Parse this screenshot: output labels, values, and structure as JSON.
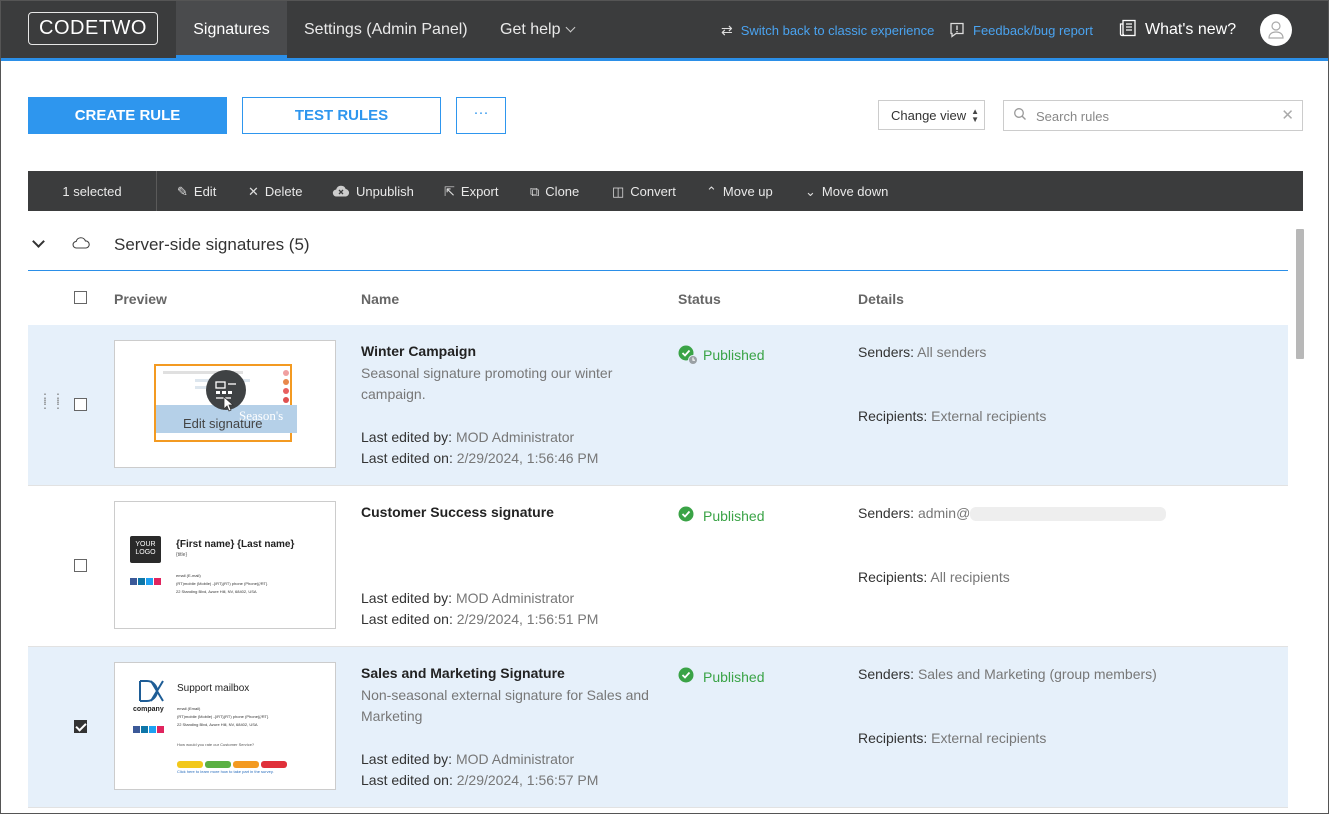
{
  "app": {
    "logo": "CODETWO",
    "nav": [
      {
        "label": "Signatures",
        "active": true
      },
      {
        "label": "Settings (Admin Panel)",
        "active": false
      },
      {
        "label": "Get help",
        "active": false
      }
    ],
    "links": {
      "switch_classic": "Switch back to classic experience",
      "feedback": "Feedback/bug report",
      "whats_new": "What's new?"
    },
    "accent_color": "#2b8fe8"
  },
  "actions": {
    "create_rule": "CREATE RULE",
    "test_rules": "TEST RULES",
    "more": "···",
    "change_view": "Change view",
    "search_placeholder": "Search rules"
  },
  "toolbar": {
    "selected": "1 selected",
    "items": [
      "Edit",
      "Delete",
      "Unpublish",
      "Export",
      "Clone",
      "Convert",
      "Move up",
      "Move down"
    ]
  },
  "group": {
    "title": "Server-side signatures (5)"
  },
  "table": {
    "headers": {
      "preview": "Preview",
      "name": "Name",
      "status": "Status",
      "details": "Details"
    },
    "rows": [
      {
        "name": "Winter Campaign",
        "description": "Seasonal signature promoting our winter campaign.",
        "edited_by_label": "Last edited by:",
        "edited_by": "MOD Administrator",
        "edited_on_label": "Last edited on:",
        "edited_on": "2/29/2024, 1:56:46 PM",
        "status": "Published",
        "senders_label": "Senders:",
        "senders": "All senders",
        "recipients_label": "Recipients:",
        "recipients": "External recipients",
        "checked": false,
        "hover_label": "Edit signature",
        "preview_text": "Season's"
      },
      {
        "name": "Customer Success signature",
        "description": "",
        "edited_by_label": "Last edited by:",
        "edited_by": "MOD Administrator",
        "edited_on_label": "Last edited on:",
        "edited_on": "2/29/2024, 1:56:51 PM",
        "status": "Published",
        "senders_label": "Senders:",
        "senders": "admin@",
        "recipients_label": "Recipients:",
        "recipients": "All recipients",
        "checked": false,
        "preview_logo": "YOUR LOGO",
        "preview_name": "{First name} {Last name}",
        "preview_title": "{title}",
        "preview_lines": [
          "email (E-mail)",
          "(RT)mobile (Mobile) -{/RT}(RT) phone (Phone){/RT}",
          "22 Standing Blvd, Azure Hill, NV, 68402, USA"
        ]
      },
      {
        "name": "Sales and Marketing Signature",
        "description": "Non-seasonal external signature for Sales and Marketing",
        "edited_by_label": "Last edited by:",
        "edited_by": "MOD Administrator",
        "edited_on_label": "Last edited on:",
        "edited_on": "2/29/2024, 1:56:57 PM",
        "status": "Published",
        "senders_label": "Senders:",
        "senders": "Sales and Marketing (group members)",
        "recipients_label": "Recipients:",
        "recipients": "External recipients",
        "checked": true,
        "preview_company": "company",
        "preview_name": "Support mailbox",
        "preview_lines": [
          "email (Email)",
          "(RT)mobile (Mobile) -{/RT}(RT) phone (Phone){/RT}",
          "22 Standing Blvd, Azure Hill, NV, 68402, USA"
        ],
        "preview_question": "How would you rate our Customer Service?",
        "preview_footer": "Click here to learn more how to take part in the survey."
      }
    ]
  },
  "status_color": "#3aa346"
}
